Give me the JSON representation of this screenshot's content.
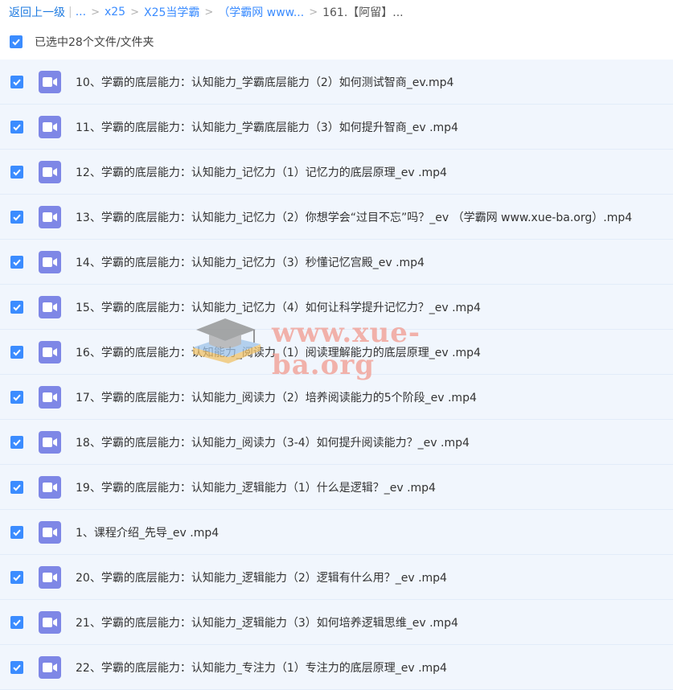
{
  "breadcrumb": {
    "back": "返回上一级",
    "ellipsis": "...",
    "items": [
      "x25",
      "X25当学霸",
      "（学霸网 www...",
      "161.【阿留】..."
    ]
  },
  "selection": {
    "label": "已选中28个文件/文件夹",
    "checked": true
  },
  "files": [
    {
      "name": "10、学霸的底层能力：认知能力_学霸底层能力（2）如何测试智商_ev.mp4",
      "checked": true,
      "icon": "video-icon"
    },
    {
      "name": "11、学霸的底层能力：认知能力_学霸底层能力（3）如何提升智商_ev .mp4",
      "checked": true,
      "icon": "video-icon"
    },
    {
      "name": "12、学霸的底层能力：认知能力_记忆力（1）记忆力的底层原理_ev .mp4",
      "checked": true,
      "icon": "video-icon"
    },
    {
      "name": "13、学霸的底层能力：认知能力_记忆力（2）你想学会“过目不忘”吗？_ev （学霸网 www.xue-ba.org）.mp4",
      "checked": true,
      "icon": "video-icon"
    },
    {
      "name": "14、学霸的底层能力：认知能力_记忆力（3）秒懂记忆宫殿_ev .mp4",
      "checked": true,
      "icon": "video-icon"
    },
    {
      "name": "15、学霸的底层能力：认知能力_记忆力（4）如何让科学提升记忆力？_ev .mp4",
      "checked": true,
      "icon": "video-icon"
    },
    {
      "name": "16、学霸的底层能力：认知能力_阅读力（1）阅读理解能力的底层原理_ev .mp4",
      "checked": true,
      "icon": "video-icon"
    },
    {
      "name": "17、学霸的底层能力：认知能力_阅读力（2）培养阅读能力的5个阶段_ev .mp4",
      "checked": true,
      "icon": "video-icon"
    },
    {
      "name": "18、学霸的底层能力：认知能力_阅读力（3-4）如何提升阅读能力？_ev .mp4",
      "checked": true,
      "icon": "video-icon"
    },
    {
      "name": "19、学霸的底层能力：认知能力_逻辑能力（1）什么是逻辑？_ev .mp4",
      "checked": true,
      "icon": "video-icon"
    },
    {
      "name": "1、课程介绍_先导_ev .mp4",
      "checked": true,
      "icon": "video-icon"
    },
    {
      "name": "20、学霸的底层能力：认知能力_逻辑能力（2）逻辑有什么用？_ev .mp4",
      "checked": true,
      "icon": "video-icon"
    },
    {
      "name": "21、学霸的底层能力：认知能力_逻辑能力（3）如何培养逻辑思维_ev .mp4",
      "checked": true,
      "icon": "video-icon"
    },
    {
      "name": "22、学霸的底层能力：认知能力_专注力（1）专注力的底层原理_ev .mp4",
      "checked": true,
      "icon": "video-icon"
    }
  ],
  "watermark": {
    "text": "www.xue-ba.org"
  },
  "colors": {
    "accent": "#3b8cff",
    "row_bg": "#f1f6fd",
    "video_icon": "#7e87e6",
    "watermark": "#f29a8f"
  }
}
